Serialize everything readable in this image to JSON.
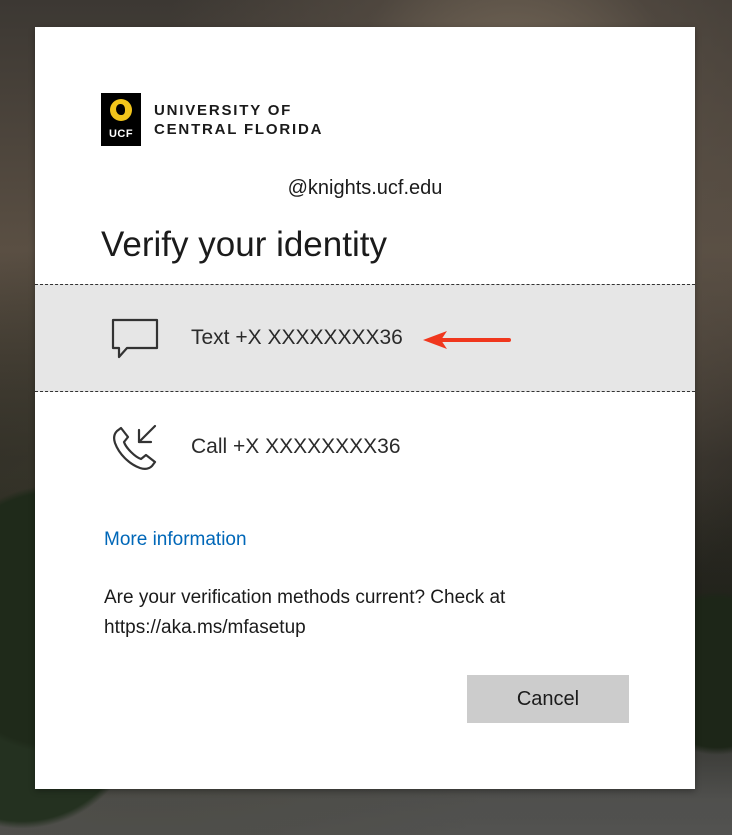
{
  "org": {
    "logo_mark_text": "UCF",
    "name_line1": "UNIVERSITY OF",
    "name_line2": "CENTRAL FLORIDA"
  },
  "account": "@knights.ucf.edu",
  "title": "Verify your identity",
  "options": [
    {
      "label": "Text +X XXXXXXXX36",
      "icon": "chat-bubble-icon",
      "highlighted": true
    },
    {
      "label": "Call +X XXXXXXXX36",
      "icon": "phone-incoming-icon",
      "highlighted": false
    }
  ],
  "more_info": "More information",
  "note": "Are your verification methods current? Check at https://aka.ms/mfasetup",
  "cancel_label": "Cancel",
  "colors": {
    "link": "#0067b8",
    "highlight_bg": "#e6e6e6",
    "annotation_arrow": "#f0371d",
    "brand_gold": "#f2c51b"
  }
}
